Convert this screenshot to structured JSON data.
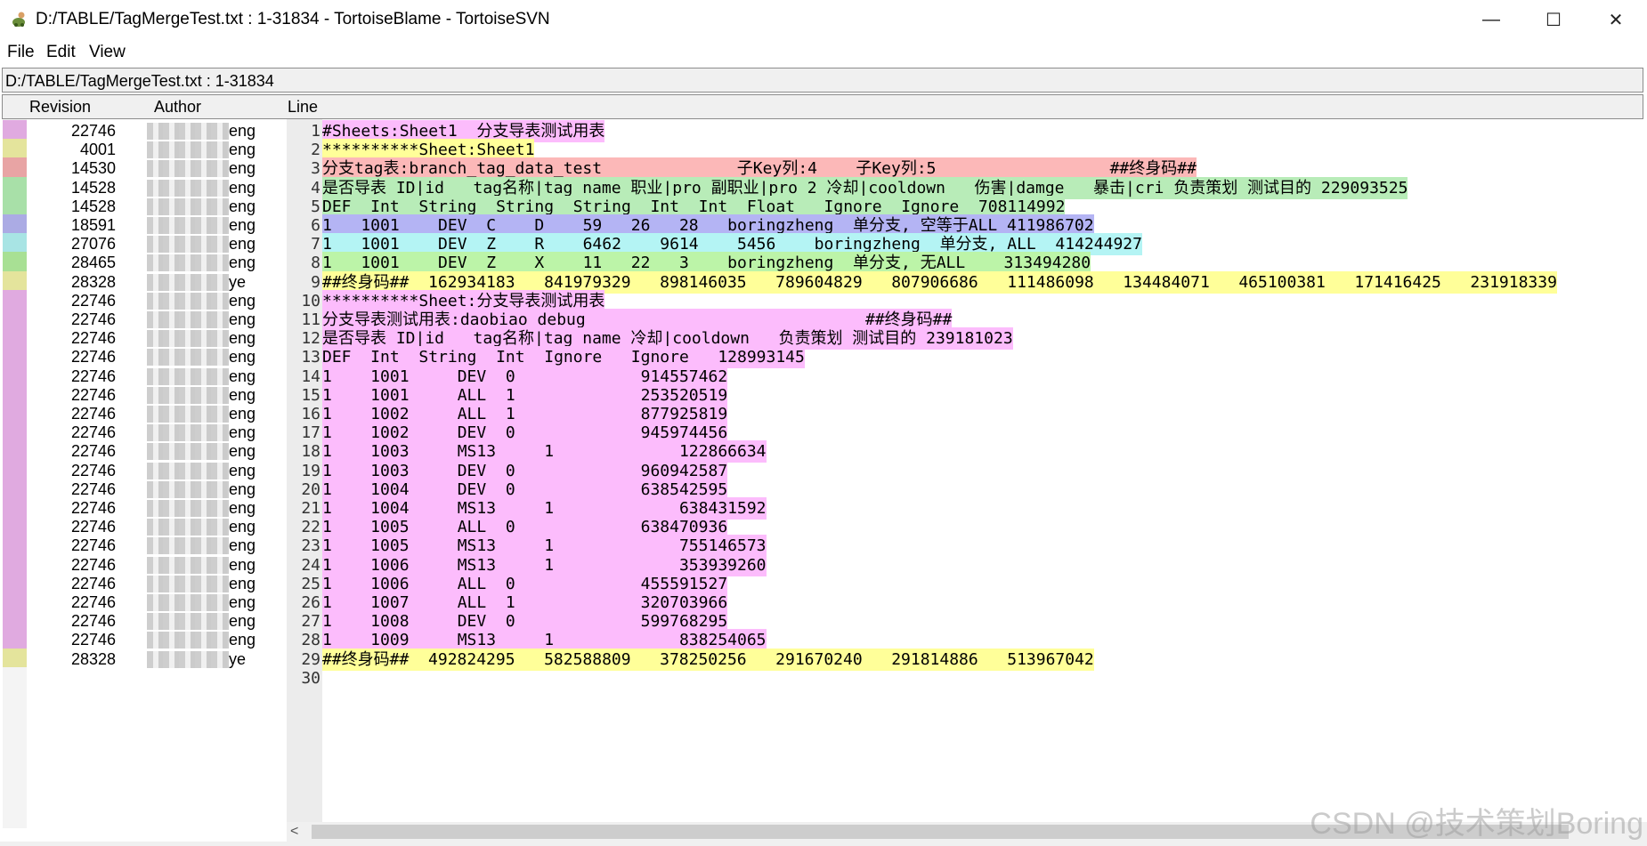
{
  "window": {
    "title": "D:/TABLE/TagMergeTest.txt : 1-31834 - TortoiseBlame - TortoiseSVN",
    "minimize_glyph": "—",
    "maximize_glyph": "☐",
    "close_glyph": "✕",
    "icon": "tortoise-icon"
  },
  "menu": [
    "File",
    "Edit",
    "View"
  ],
  "path_bar": "D:/TABLE/TagMergeTest.txt : 1-31834",
  "columns": {
    "revision": "Revision",
    "author": "Author",
    "line": "Line"
  },
  "colors": {
    "pink": "#fcbcfc",
    "yellow": "#ffff99",
    "red": "#fcb8b8",
    "green": "#b8ecb8",
    "blue": "#b4b4f4",
    "cyan": "#b4f4f4",
    "lime": "#bcf4a8"
  },
  "strip_colors": {
    "pink": "#e0aae0",
    "khaki": "#e4e49c",
    "rose": "#e8a4a4",
    "mint": "#a8e0a8",
    "periwinkle": "#ababe4",
    "aqua": "#a8e4e4",
    "grass": "#a8e094"
  },
  "lines": [
    {
      "num": "1",
      "rev": "22746",
      "author_suffix": "eng",
      "text": "#Sheets:Sheet1  分支导表测试用表",
      "color": "pink",
      "strip": "pink"
    },
    {
      "num": "2",
      "rev": "4001",
      "author_suffix": "eng",
      "text": "**********Sheet:Sheet1",
      "color": "yellow",
      "strip": "khaki"
    },
    {
      "num": "3",
      "rev": "14530",
      "author_suffix": "eng",
      "text": "分支tag表:branch_tag_data_test              子Key列:4    子Key列:5                  ##终身码##",
      "color": "red",
      "strip": "rose"
    },
    {
      "num": "4",
      "rev": "14528",
      "author_suffix": "eng",
      "text": "是否导表 ID|id   tag名称|tag_name 职业|pro 副职业|pro_2 冷却|cooldown   伤害|damge   暴击|cri 负责策划 测试目的 229093525",
      "color": "green",
      "strip": "mint"
    },
    {
      "num": "5",
      "rev": "14528",
      "author_suffix": "eng",
      "text": "DEF  Int  String  String  String  Int  Int  Float   Ignore  Ignore  708114992",
      "color": "green",
      "strip": "mint"
    },
    {
      "num": "6",
      "rev": "18591",
      "author_suffix": "eng",
      "text": "1   1001    DEV  C    D    59   26   28   boringzheng  单分支, 空等于ALL 411986702",
      "color": "blue",
      "strip": "periwinkle"
    },
    {
      "num": "7",
      "rev": "27076",
      "author_suffix": "eng",
      "text": "1   1001    DEV  Z    R    6462    9614    5456    boringzheng  单分支, ALL  414244927",
      "color": "cyan",
      "strip": "aqua"
    },
    {
      "num": "8",
      "rev": "28465",
      "author_suffix": "eng",
      "text": "1   1001    DEV  Z    X    11   22   3    boringzheng  单分支, 无ALL    313494280",
      "color": "lime",
      "strip": "grass"
    },
    {
      "num": "9",
      "rev": "28328",
      "author_suffix": "ye",
      "text": "##终身码##  162934183   841979329   898146035   789604829   807906686   111486098   134484071   465100381   171416425   231918339",
      "color": "yellow",
      "strip": "khaki"
    },
    {
      "num": "10",
      "rev": "22746",
      "author_suffix": "eng",
      "text": "**********Sheet:分支导表测试用表",
      "color": "pink",
      "strip": "pink"
    },
    {
      "num": "11",
      "rev": "22746",
      "author_suffix": "eng",
      "text": "分支导表测试用表:daobiao_debug                             ##终身码##",
      "color": "pink",
      "strip": "pink"
    },
    {
      "num": "12",
      "rev": "22746",
      "author_suffix": "eng",
      "text": "是否导表 ID|id   tag名称|tag_name 冷却|cooldown   负责策划 测试目的 239181023",
      "color": "pink",
      "strip": "pink"
    },
    {
      "num": "13",
      "rev": "22746",
      "author_suffix": "eng",
      "text": "DEF  Int  String  Int  Ignore   Ignore   128993145",
      "color": "pink",
      "strip": "pink"
    },
    {
      "num": "14",
      "rev": "22746",
      "author_suffix": "eng",
      "text": "1    1001     DEV  0             914557462",
      "color": "pink",
      "strip": "pink"
    },
    {
      "num": "15",
      "rev": "22746",
      "author_suffix": "eng",
      "text": "1    1001     ALL  1             253520519",
      "color": "pink",
      "strip": "pink"
    },
    {
      "num": "16",
      "rev": "22746",
      "author_suffix": "eng",
      "text": "1    1002     ALL  1             877925819",
      "color": "pink",
      "strip": "pink"
    },
    {
      "num": "17",
      "rev": "22746",
      "author_suffix": "eng",
      "text": "1    1002     DEV  0             945974456",
      "color": "pink",
      "strip": "pink"
    },
    {
      "num": "18",
      "rev": "22746",
      "author_suffix": "eng",
      "text": "1    1003     MS13     1             122866634",
      "color": "pink",
      "strip": "pink"
    },
    {
      "num": "19",
      "rev": "22746",
      "author_suffix": "eng",
      "text": "1    1003     DEV  0             960942587",
      "color": "pink",
      "strip": "pink"
    },
    {
      "num": "20",
      "rev": "22746",
      "author_suffix": "eng",
      "text": "1    1004     DEV  0             638542595",
      "color": "pink",
      "strip": "pink"
    },
    {
      "num": "21",
      "rev": "22746",
      "author_suffix": "eng",
      "text": "1    1004     MS13     1             638431592",
      "color": "pink",
      "strip": "pink"
    },
    {
      "num": "22",
      "rev": "22746",
      "author_suffix": "eng",
      "text": "1    1005     ALL  0             638470936",
      "color": "pink",
      "strip": "pink"
    },
    {
      "num": "23",
      "rev": "22746",
      "author_suffix": "eng",
      "text": "1    1005     MS13     1             755146573",
      "color": "pink",
      "strip": "pink"
    },
    {
      "num": "24",
      "rev": "22746",
      "author_suffix": "eng",
      "text": "1    1006     MS13     1             353939260",
      "color": "pink",
      "strip": "pink"
    },
    {
      "num": "25",
      "rev": "22746",
      "author_suffix": "eng",
      "text": "1    1006     ALL  0             455591527",
      "color": "pink",
      "strip": "pink"
    },
    {
      "num": "26",
      "rev": "22746",
      "author_suffix": "eng",
      "text": "1    1007     ALL  1             320703966",
      "color": "pink",
      "strip": "pink"
    },
    {
      "num": "27",
      "rev": "22746",
      "author_suffix": "eng",
      "text": "1    1008     DEV  0             599768295",
      "color": "pink",
      "strip": "pink"
    },
    {
      "num": "28",
      "rev": "22746",
      "author_suffix": "eng",
      "text": "1    1009     MS13     1             838254065",
      "color": "pink",
      "strip": "pink"
    },
    {
      "num": "29",
      "rev": "28328",
      "author_suffix": "ye",
      "text": "##终身码##  492824295   582588809   378250256   291670240   291814886   513967042",
      "color": "yellow",
      "strip": "khaki"
    },
    {
      "num": "30",
      "rev": "",
      "author_suffix": "",
      "text": "",
      "color": "",
      "strip": ""
    }
  ],
  "scroll": {
    "left_arrow": "<"
  },
  "watermark": "CSDN @技术策划Boring"
}
